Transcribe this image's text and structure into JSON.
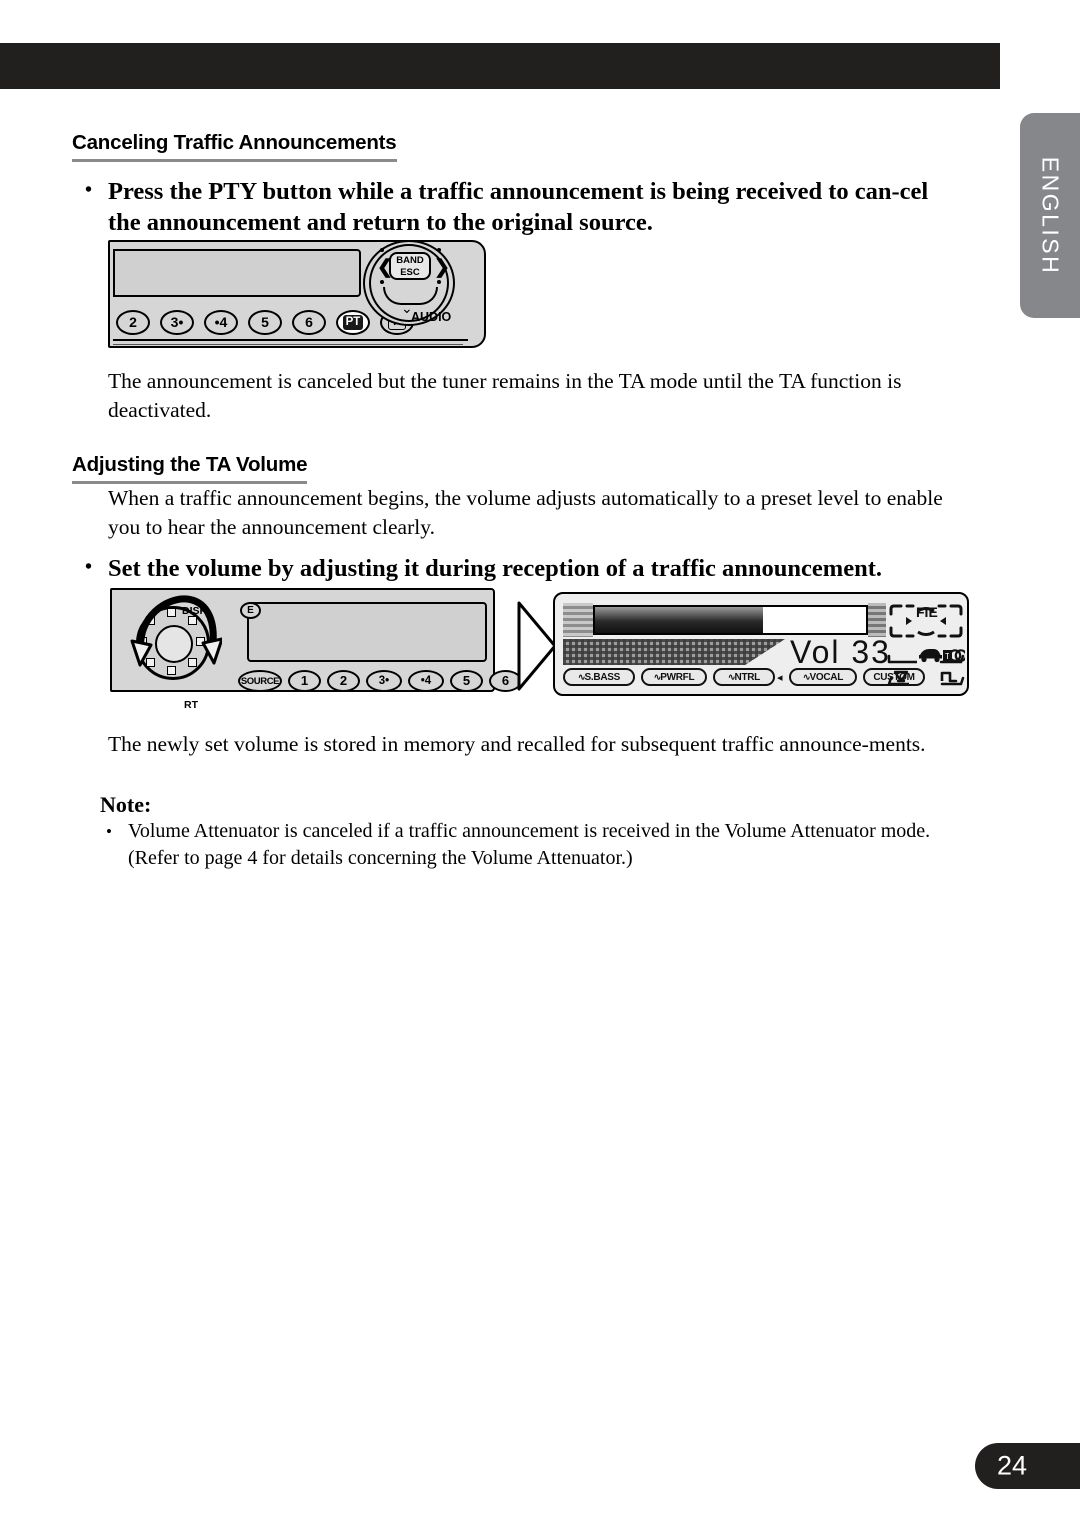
{
  "page": {
    "number": "24",
    "language_tab": "ENGLISH"
  },
  "sections": [
    {
      "heading": "Canceling Traffic Announcements",
      "bullet": "Press the PTY button while a traffic announcement is being received to can-cel the announcement and return to the original source.",
      "body": "The announcement is canceled but the tuner remains in the TA mode until the TA function is deactivated."
    },
    {
      "heading": "Adjusting the TA Volume",
      "intro": "When a traffic announcement begins, the volume adjusts automatically to a preset level to enable you to hear the announcement clearly.",
      "bullet": "Set the volume by adjusting it during reception of a traffic announcement.",
      "body": "The newly set volume is stored in memory and recalled for subsequent traffic announce-ments."
    }
  ],
  "note": {
    "title": "Note:",
    "items": [
      "Volume Attenuator is canceled if a traffic announcement is received in the Volume Attenuator mode. (Refer to page 4 for details concerning the Volume Attenuator.)"
    ]
  },
  "illustration_1": {
    "caption": "car stereo head unit with PTY button highlighted",
    "preset_buttons": [
      "2",
      "3•",
      "•4",
      "5",
      "6"
    ],
    "pt_button": "PT",
    "p_button": "P",
    "band_esc": "BAND\nESC",
    "band_label_line1": "BAND",
    "band_label_line2": "ESC",
    "audio_label": "AUDIO",
    "left_arrow": "❮",
    "right_arrow": "❯"
  },
  "illustration_2": {
    "caption": "car stereo head unit with rotary volume knob being turned",
    "disp_label": "DISP",
    "rt_label": "RT",
    "e_label": "E",
    "source_button": "SOURCE",
    "preset_buttons": [
      "1",
      "2",
      "3•",
      "•4",
      "5",
      "6"
    ]
  },
  "lcd_display": {
    "volume_text": "Vol 33",
    "volume_value": 33,
    "bar_fill_percent": 62,
    "eq_tags": [
      "S.BASS",
      "PWRFL",
      "NTRL",
      "VOCAL",
      "CUSTOM"
    ],
    "fie_label": "FIE"
  },
  "colors": {
    "header_bar": "#221f1f",
    "lang_tab": "#85878a",
    "page_tab": "#221f1f",
    "heading_rule": "#8a8a8a",
    "unit_body": "#d6d6d6",
    "lcd_background": "#eeeeee"
  }
}
